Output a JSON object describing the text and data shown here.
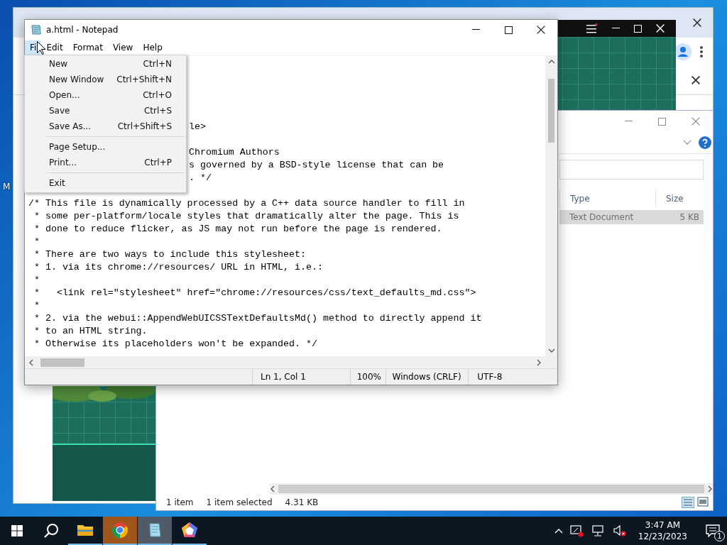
{
  "desktop": {
    "icon_labels": [
      "M"
    ]
  },
  "explorer": {
    "columns": [
      "Type",
      "Size"
    ],
    "rows": [
      {
        "type": "Text Document",
        "size": "5 KB",
        "selected": true
      }
    ],
    "status": [
      "1 item",
      "1 item selected",
      "4.31 KB"
    ]
  },
  "notepad": {
    "title": "a.html - Notepad",
    "menus": [
      {
        "label": "Fi",
        "selected": true
      },
      {
        "label": "Edit",
        "selected": false
      },
      {
        "label": "Format",
        "selected": false
      },
      {
        "label": "View",
        "selected": false
      },
      {
        "label": "Help",
        "selected": false
      }
    ],
    "partial_lines": [
      "le>",
      "Chromium Authors",
      "s governed by a BSD-style license that can be",
      ". */"
    ],
    "lines": [
      "/* This file is dynamically processed by a C++ data source handler to fill in",
      " * some per-platform/locale styles that dramatically alter the page. This is",
      " * done to reduce flicker, as JS may not run before the page is rendered.",
      " *",
      " * There are two ways to include this stylesheet:",
      " * 1. via its chrome://resources/ URL in HTML, i.e.:",
      " *",
      " *   <link rel=\"stylesheet\" href=\"chrome://resources/css/text_defaults_md.css\">",
      " *",
      " * 2. via the webui::AppendWebUICSSTextDefaultsMd() method to directly append it",
      " * to an HTML string.",
      " * Otherwise its placeholders won't be expanded. */"
    ],
    "status": [
      "Ln 1, Col 1",
      "100%",
      "Windows (CRLF)",
      "UTF-8"
    ]
  },
  "file_menu": [
    {
      "kind": "item",
      "label": "New",
      "shortcut": "Ctrl+N"
    },
    {
      "kind": "item",
      "label": "New Window",
      "shortcut": "Ctrl+Shift+N"
    },
    {
      "kind": "item",
      "label": "Open...",
      "shortcut": "Ctrl+O"
    },
    {
      "kind": "item",
      "label": "Save",
      "shortcut": "Ctrl+S"
    },
    {
      "kind": "item",
      "label": "Save As...",
      "shortcut": "Ctrl+Shift+S"
    },
    {
      "kind": "separator"
    },
    {
      "kind": "item",
      "label": "Page Setup..."
    },
    {
      "kind": "item",
      "label": "Print...",
      "shortcut": "Ctrl+P"
    },
    {
      "kind": "separator"
    },
    {
      "kind": "item",
      "label": "Exit"
    }
  ],
  "taskbar": {
    "apps": [
      {
        "kind": "explorer",
        "selected": false,
        "flashing": false
      },
      {
        "kind": "chrome",
        "selected": false,
        "flashing": true
      },
      {
        "kind": "notepad",
        "selected": true,
        "flashing": false
      },
      {
        "kind": "pentagon",
        "selected": false,
        "flashing": false
      }
    ],
    "time": "3:47 AM",
    "date": "12/23/2023",
    "notifications": "1"
  }
}
